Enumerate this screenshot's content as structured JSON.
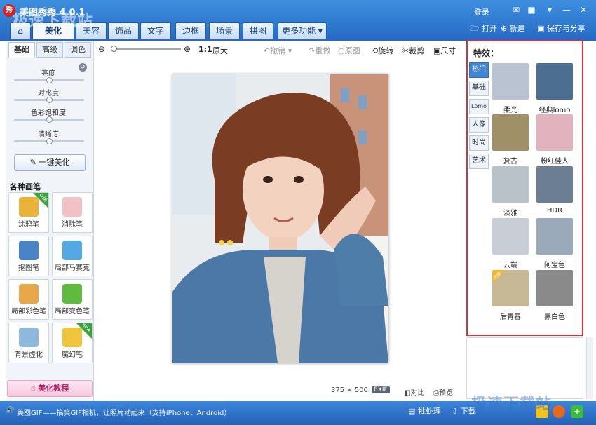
{
  "title": {
    "logo": "秀",
    "text": "美图秀秀 4.0.1",
    "login": "登录"
  },
  "tabs": [
    {
      "label": "⌂"
    },
    {
      "label": "美化"
    },
    {
      "label": "美容"
    },
    {
      "label": "饰品"
    },
    {
      "label": "文字"
    },
    {
      "label": "边框"
    },
    {
      "label": "场景"
    },
    {
      "label": "拼图"
    },
    {
      "label": "更多功能 ▾"
    }
  ],
  "toolbar": {
    "open": "打开",
    "new": "新建",
    "save": "保存与分享"
  },
  "left": {
    "subtabs": [
      "基础",
      "高级",
      "调色"
    ],
    "sliders": [
      {
        "label": "亮度",
        "value": 0.5
      },
      {
        "label": "对比度",
        "value": 0.5
      },
      {
        "label": "色彩饱和度",
        "value": 0.5
      },
      {
        "label": "清晰度",
        "value": 0.5
      }
    ],
    "onekey": "一键美化",
    "brushes_title": "各种画笔",
    "brushes": [
      {
        "label": "涂鸦笔",
        "badge": "升级",
        "color": "#e9b23a"
      },
      {
        "label": "消除笔",
        "badge": "",
        "color": "#f2c1c6"
      },
      {
        "label": "抠图笔",
        "badge": "",
        "color": "#4a84c8"
      },
      {
        "label": "局部马赛克",
        "badge": "",
        "color": "#54a8e4"
      },
      {
        "label": "局部彩色笔",
        "badge": "",
        "color": "#e8a84a"
      },
      {
        "label": "局部变色笔",
        "badge": "",
        "color": "#5fbb3e"
      },
      {
        "label": "背景虚化",
        "badge": "",
        "color": "#8fb8dd"
      },
      {
        "label": "魔幻笔",
        "badge": "new",
        "color": "#f1c53b"
      }
    ],
    "tutorial": "美化教程"
  },
  "zoom": {
    "ratio": "1:1",
    "original": "原大",
    "undo": "撤销",
    "redo": "重做",
    "reset": "原图",
    "rotate": "旋转",
    "crop": "裁剪",
    "size": "尺寸"
  },
  "canvas": {
    "dims": "375 × 500",
    "exif": "EXIF",
    "compare": "对比",
    "preview": "预览"
  },
  "effects": {
    "title": "特效：",
    "tabs": [
      "热门",
      "基础",
      "Lomo",
      "人像",
      "时尚",
      "艺术"
    ],
    "items": [
      {
        "label": "柔光",
        "tint": "#b9c3d2"
      },
      {
        "label": "经典lomo",
        "tint": "#4b6e91"
      },
      {
        "label": "复古",
        "tint": "#a09068"
      },
      {
        "label": "粉红佳人",
        "tint": "#e2b2be"
      },
      {
        "label": "淡雅",
        "tint": "#b8c2c8"
      },
      {
        "label": "HDR",
        "tint": "#6c7e93"
      },
      {
        "label": "云端",
        "tint": "#c9ced6"
      },
      {
        "label": "阿宝色",
        "tint": "#9aaaba"
      },
      {
        "label": "后青春",
        "tint": "#c7b896",
        "badge": "升级"
      },
      {
        "label": "黑白色",
        "tint": "#8a8a8a"
      }
    ]
  },
  "status": {
    "text": "美图GIF——搞笑GIF相机，让照片动起来（支持iPhone、Android）",
    "batch": "批处理",
    "download": "下载"
  },
  "watermarks": {
    "top": "极速下载站",
    "bottom": "极速下载站"
  }
}
